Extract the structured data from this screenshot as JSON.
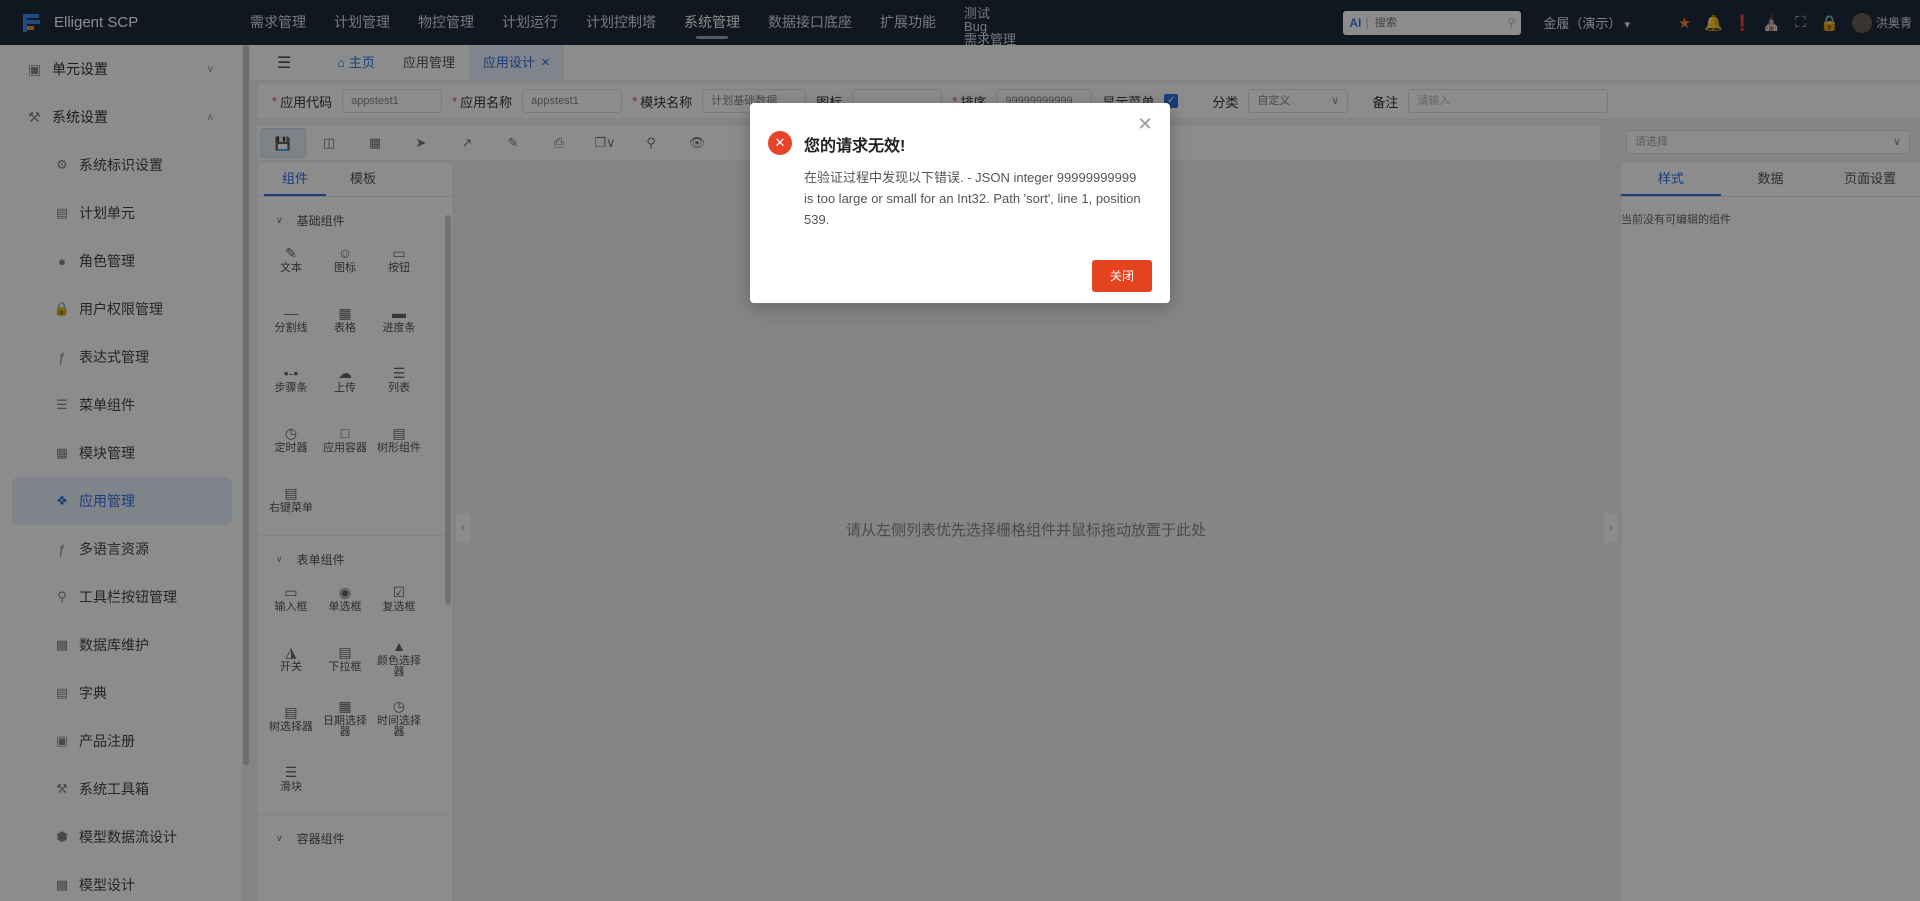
{
  "app": {
    "name": "Elligent SCP"
  },
  "topnav": {
    "items": [
      "需求管理",
      "计划管理",
      "物控管理",
      "计划运行",
      "计划控制塔",
      "系统管理",
      "数据接口底座",
      "扩展功能"
    ],
    "active_index": 5,
    "multi_item": [
      "测试",
      "Bug",
      "需求管理"
    ]
  },
  "header": {
    "search_ai": "AI",
    "search_placeholder": "搜索",
    "company": "金履（演示）",
    "user": "洪奥青"
  },
  "sidebar": {
    "groups": [
      {
        "label": "单元设置",
        "icon": "unit-settings-icon",
        "expanded": false
      },
      {
        "label": "系统设置",
        "icon": "system-settings-icon",
        "expanded": true
      }
    ],
    "items": [
      {
        "label": "系统标识设置",
        "icon": "gear-icon"
      },
      {
        "label": "计划单元",
        "icon": "document-icon"
      },
      {
        "label": "角色管理",
        "icon": "user-icon"
      },
      {
        "label": "用户权限管理",
        "icon": "lock-icon"
      },
      {
        "label": "表达式管理",
        "icon": "formula-icon"
      },
      {
        "label": "菜单组件",
        "icon": "list-icon"
      },
      {
        "label": "模块管理",
        "icon": "table-icon"
      },
      {
        "label": "应用管理",
        "icon": "apps-icon",
        "active": true
      },
      {
        "label": "多语言资源",
        "icon": "formula-icon"
      },
      {
        "label": "工具栏按钮管理",
        "icon": "pin-icon"
      },
      {
        "label": "数据库维护",
        "icon": "database-icon"
      },
      {
        "label": "字典",
        "icon": "book-icon"
      },
      {
        "label": "产品注册",
        "icon": "register-icon"
      },
      {
        "label": "系统工具箱",
        "icon": "tool-icon"
      },
      {
        "label": "模型数据流设计",
        "icon": "cube-icon"
      },
      {
        "label": "模型设计",
        "icon": "database-icon"
      }
    ]
  },
  "tabs": {
    "home": "主页",
    "app_mgmt": "应用管理",
    "current": "应用设计"
  },
  "form": {
    "app_code_label": "应用代码",
    "app_code_value": "appstest1",
    "app_name_label": "应用名称",
    "app_name_value": "appstest1",
    "module_label": "模块名称",
    "module_value": "计划基础数据",
    "icon_label": "图标",
    "sort_label": "排序",
    "sort_value": "99999999999",
    "show_menu_label": "显示菜单",
    "show_menu_checked": true,
    "category_label": "分类",
    "category_value": "自定义",
    "remark_label": "备注",
    "remark_placeholder": "请输入"
  },
  "right_select": {
    "placeholder": "请选择"
  },
  "left_panel": {
    "tabs": [
      "组件",
      "模板"
    ],
    "sections": [
      {
        "title": "基础组件",
        "items": [
          "文本",
          "图标",
          "按钮",
          "分割线",
          "表格",
          "进度条",
          "步骤条",
          "上传",
          "列表",
          "定时器",
          "应用容器",
          "树形组件",
          "右键菜单"
        ]
      },
      {
        "title": "表单组件",
        "items": [
          "输入框",
          "单选框",
          "复选框",
          "开关",
          "下拉框",
          "颜色选择器",
          "树选择器",
          "日期选择器",
          "时间选择器",
          "滑块"
        ]
      },
      {
        "title": "容器组件",
        "items": []
      }
    ]
  },
  "canvas": {
    "hint": "请从左侧列表优先选择栅格组件并鼠标拖动放置于此处"
  },
  "right_panel": {
    "tabs": [
      "样式",
      "数据",
      "页面设置"
    ],
    "message": "当前没有可编辑的组件"
  },
  "dialog": {
    "title": "您的请求无效!",
    "message": "在验证过程中发现以下错误. - JSON integer 99999999999 is too large or small for an Int32. Path 'sort', line 1, position 539.",
    "button": "关闭"
  },
  "colors": {
    "topbar": "#1f2a3c",
    "accent": "#2f6fdf",
    "danger": "#e5421f",
    "star": "#f0843a"
  }
}
